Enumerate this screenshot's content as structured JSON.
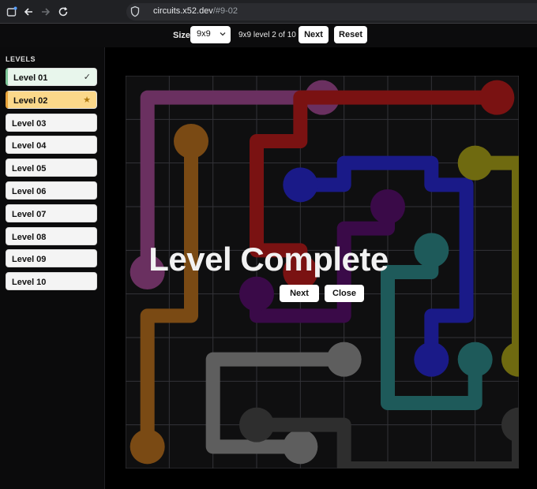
{
  "browser": {
    "url_host": "circuits.x52.dev",
    "url_path": "/#9-02"
  },
  "toolbar": {
    "size_label": "Size",
    "size_value": "9x9",
    "status": "9x9 level 2 of 10",
    "next_label": "Next",
    "reset_label": "Reset"
  },
  "sidebar": {
    "title": "LEVELS",
    "levels": [
      {
        "label": "Level 01",
        "state": "complete"
      },
      {
        "label": "Level 02",
        "state": "current"
      },
      {
        "label": "Level 03",
        "state": "locked"
      },
      {
        "label": "Level 04",
        "state": "locked"
      },
      {
        "label": "Level 05",
        "state": "locked"
      },
      {
        "label": "Level 06",
        "state": "locked"
      },
      {
        "label": "Level 07",
        "state": "locked"
      },
      {
        "label": "Level 08",
        "state": "locked"
      },
      {
        "label": "Level 09",
        "state": "locked"
      },
      {
        "label": "Level 10",
        "state": "locked"
      }
    ],
    "complete_mark": "✓",
    "current_mark": "★"
  },
  "board": {
    "size": 9,
    "flows": [
      {
        "name": "purple",
        "color": "#6a3060",
        "path": [
          [
            4,
            0
          ],
          [
            3,
            0
          ],
          [
            2,
            0
          ],
          [
            1,
            0
          ],
          [
            0,
            0
          ],
          [
            0,
            1
          ],
          [
            0,
            2
          ],
          [
            0,
            3
          ],
          [
            0,
            4
          ]
        ]
      },
      {
        "name": "orange",
        "color": "#7a4a14",
        "path": [
          [
            1,
            1
          ],
          [
            1,
            2
          ],
          [
            1,
            3
          ],
          [
            1,
            4
          ],
          [
            1,
            5
          ],
          [
            0,
            5
          ],
          [
            0,
            6
          ],
          [
            0,
            7
          ],
          [
            0,
            8
          ]
        ]
      },
      {
        "name": "red",
        "color": "#7a1212",
        "path": [
          [
            8,
            0
          ],
          [
            7,
            0
          ],
          [
            6,
            0
          ],
          [
            5,
            0
          ],
          [
            4,
            0.0001
          ],
          [
            3.5,
            0
          ],
          [
            3.5,
            1
          ],
          [
            2.5,
            1
          ],
          [
            2.5,
            2
          ],
          [
            2.5,
            3
          ],
          [
            2.5,
            3.5
          ],
          [
            3.5,
            3.5
          ],
          [
            3.5,
            4
          ]
        ]
      },
      {
        "name": "blue",
        "color": "#1a1a88",
        "path": [
          [
            3.5,
            2
          ],
          [
            4.5,
            2
          ],
          [
            4.5,
            1.5
          ],
          [
            5.5,
            1.5
          ],
          [
            6.5,
            1.5
          ],
          [
            6.5,
            2
          ],
          [
            7.3,
            2
          ],
          [
            7.3,
            3
          ],
          [
            7.3,
            4
          ],
          [
            7.3,
            5
          ],
          [
            6.5,
            5
          ],
          [
            6.5,
            6
          ]
        ]
      },
      {
        "name": "dark-purple",
        "color": "#3a0a48",
        "path": [
          [
            5.5,
            2.5
          ],
          [
            5.5,
            3
          ],
          [
            4.5,
            3
          ],
          [
            4.5,
            4
          ],
          [
            4.5,
            5
          ],
          [
            3,
            5
          ],
          [
            2.5,
            5
          ],
          [
            2.5,
            4.5
          ]
        ]
      },
      {
        "name": "yellow",
        "color": "#6f6a10",
        "path": [
          [
            7.5,
            1.5
          ],
          [
            8.5,
            1.5
          ],
          [
            8.5,
            2
          ],
          [
            8.5,
            3
          ],
          [
            8.5,
            4
          ],
          [
            8.5,
            5
          ],
          [
            8.5,
            6
          ]
        ]
      },
      {
        "name": "teal",
        "color": "#1e5a5a",
        "path": [
          [
            6.5,
            3.5
          ],
          [
            6.5,
            4
          ],
          [
            5.5,
            4
          ],
          [
            5.5,
            5
          ],
          [
            5.5,
            6
          ],
          [
            5.5,
            7
          ],
          [
            6.5,
            7
          ],
          [
            7.5,
            7
          ],
          [
            7.5,
            6
          ]
        ]
      },
      {
        "name": "gray",
        "color": "#5e5e5e",
        "path": [
          [
            4.5,
            6
          ],
          [
            3.5,
            6
          ],
          [
            2.5,
            6
          ],
          [
            1.5,
            6
          ],
          [
            1.5,
            7
          ],
          [
            1.5,
            8
          ],
          [
            2.5,
            8
          ],
          [
            3.5,
            8
          ]
        ]
      },
      {
        "name": "dark-gray",
        "color": "#2e2e2e",
        "path": [
          [
            2.5,
            7.5
          ],
          [
            3.5,
            7.5
          ],
          [
            4.5,
            7.5
          ],
          [
            4.5,
            8.5
          ],
          [
            5.5,
            8.5
          ],
          [
            6.5,
            8.5
          ],
          [
            7.5,
            8.5
          ],
          [
            8.5,
            8.5
          ],
          [
            8.5,
            7.5
          ]
        ]
      }
    ]
  },
  "overlay": {
    "title": "Level Complete",
    "next_label": "Next",
    "close_label": "Close"
  },
  "icons": [
    "tab-icon",
    "back-arrow-icon",
    "forward-arrow-icon",
    "reload-icon",
    "shield-icon",
    "chevron-down-icon",
    "checkmark-icon",
    "star-icon"
  ]
}
